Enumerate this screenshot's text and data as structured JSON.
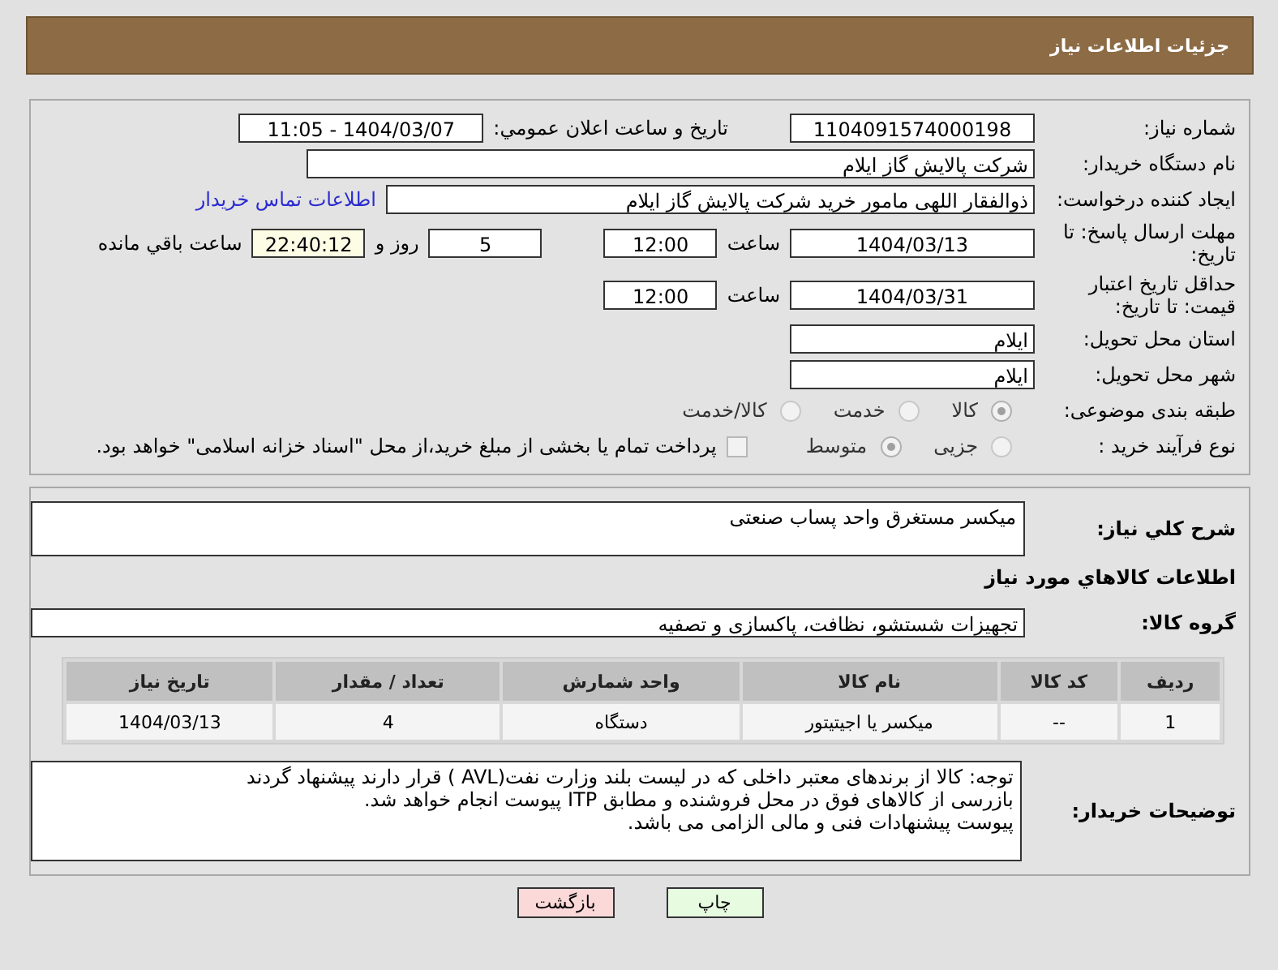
{
  "header": {
    "title": "جزئیات اطلاعات نیاز"
  },
  "need_number": {
    "label": "شماره نیاز:",
    "value": "1104091574000198"
  },
  "announce": {
    "label": "تاریخ و ساعت اعلان عمومي:",
    "value": "1404/03/07 - 11:05"
  },
  "buyer": {
    "label": "نام دستگاه خریدار:",
    "value": "شرکت پالایش گاز ایلام"
  },
  "creator": {
    "label": "ایجاد کننده درخواست:",
    "value": "ذوالفقار اللهی مامور خرید شرکت پالایش گاز ایلام",
    "link": "اطلاعات تماس خریدار"
  },
  "deadline": {
    "label": "مهلت ارسال پاسخ: تا تاریخ:",
    "date": "1404/03/13",
    "time_label": "ساعت",
    "time": "12:00",
    "days": "5",
    "days_label": "روز و",
    "remaining": "22:40:12",
    "remaining_label": "ساعت باقي مانده"
  },
  "validity": {
    "label": "حداقل تاریخ اعتبار قیمت: تا تاریخ:",
    "date": "1404/03/31",
    "time_label": "ساعت",
    "time": "12:00"
  },
  "province": {
    "label": "استان محل تحویل:",
    "value": "ایلام"
  },
  "city": {
    "label": "شهر محل تحویل:",
    "value": "ایلام"
  },
  "category": {
    "label": "طبقه بندی موضوعی:",
    "options": [
      {
        "label": "کالا",
        "selected": true
      },
      {
        "label": "خدمت",
        "selected": false
      },
      {
        "label": "کالا/خدمت",
        "selected": false
      }
    ]
  },
  "process": {
    "label": "نوع فرآیند خرید :",
    "options": [
      {
        "label": "جزیی",
        "selected": false
      },
      {
        "label": "متوسط",
        "selected": true
      }
    ],
    "payment": {
      "checked": false,
      "text": "پرداخت تمام یا بخشی از مبلغ خرید،از محل \"اسناد خزانه اسلامی\" خواهد بود."
    }
  },
  "description": {
    "label": "شرح کلي نياز:",
    "value": "میکسر مستغرق واحد پساب صنعتی"
  },
  "goods_title": "اطلاعات کالاهاي مورد نياز",
  "group": {
    "label": "گروه کالا:",
    "value": "تجهیزات شستشو، نظافت، پاکسازی و تصفیه"
  },
  "table": {
    "columns": [
      "ردیف",
      "کد کالا",
      "نام کالا",
      "واحد شمارش",
      "تعداد / مقدار",
      "تاریخ نیاز"
    ],
    "rows": [
      [
        "1",
        "--",
        "میکسر یا اجیتیتور",
        "دستگاه",
        "4",
        "1404/03/13"
      ]
    ]
  },
  "notes": {
    "label": "توضیحات خریدار:",
    "lines": [
      "توجه: کالا از برندهای معتبر داخلی که در لیست بلند وزارت نفت(AVL ) قرار دارند پیشنهاد گردند",
      "بازرسی از کالاهای فوق در محل فروشنده و مطابق ITP پیوست انجام خواهد شد.",
      "پیوست پیشنهادات فنی و مالی الزامی می باشد."
    ]
  },
  "buttons": [
    {
      "label": "چاپ",
      "kind": "print"
    },
    {
      "label": "بازگشت",
      "kind": "back"
    }
  ]
}
